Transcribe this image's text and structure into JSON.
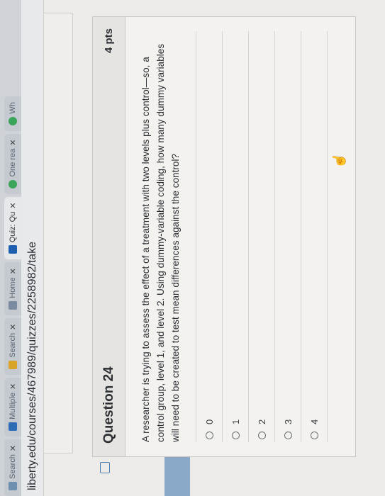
{
  "browser": {
    "tabs": [
      {
        "label": "Search",
        "active": false
      },
      {
        "label": "Multiple",
        "active": false
      },
      {
        "label": "Search",
        "active": false
      },
      {
        "label": "Home",
        "active": false
      },
      {
        "label": "Quiz: Qu",
        "active": true
      },
      {
        "label": "One rea",
        "active": false
      },
      {
        "label": "Wh",
        "active": false
      }
    ],
    "url": "liberty.edu/courses/467989/quizzes/2258982/take"
  },
  "question": {
    "title": "Question 24",
    "points": "4 pts",
    "text": "A researcher is trying to assess the effect of a treatment with two levels plus control—so, a control group, level 1, and level 2. Using dummy-variable coding, how many dummy variables will need to be created to test mean differences against the control?",
    "options": [
      "0",
      "1",
      "2",
      "3",
      "4"
    ]
  },
  "colors": {
    "accent": "#4a7fb5",
    "sidebar_accent": "#8aa9c8"
  }
}
